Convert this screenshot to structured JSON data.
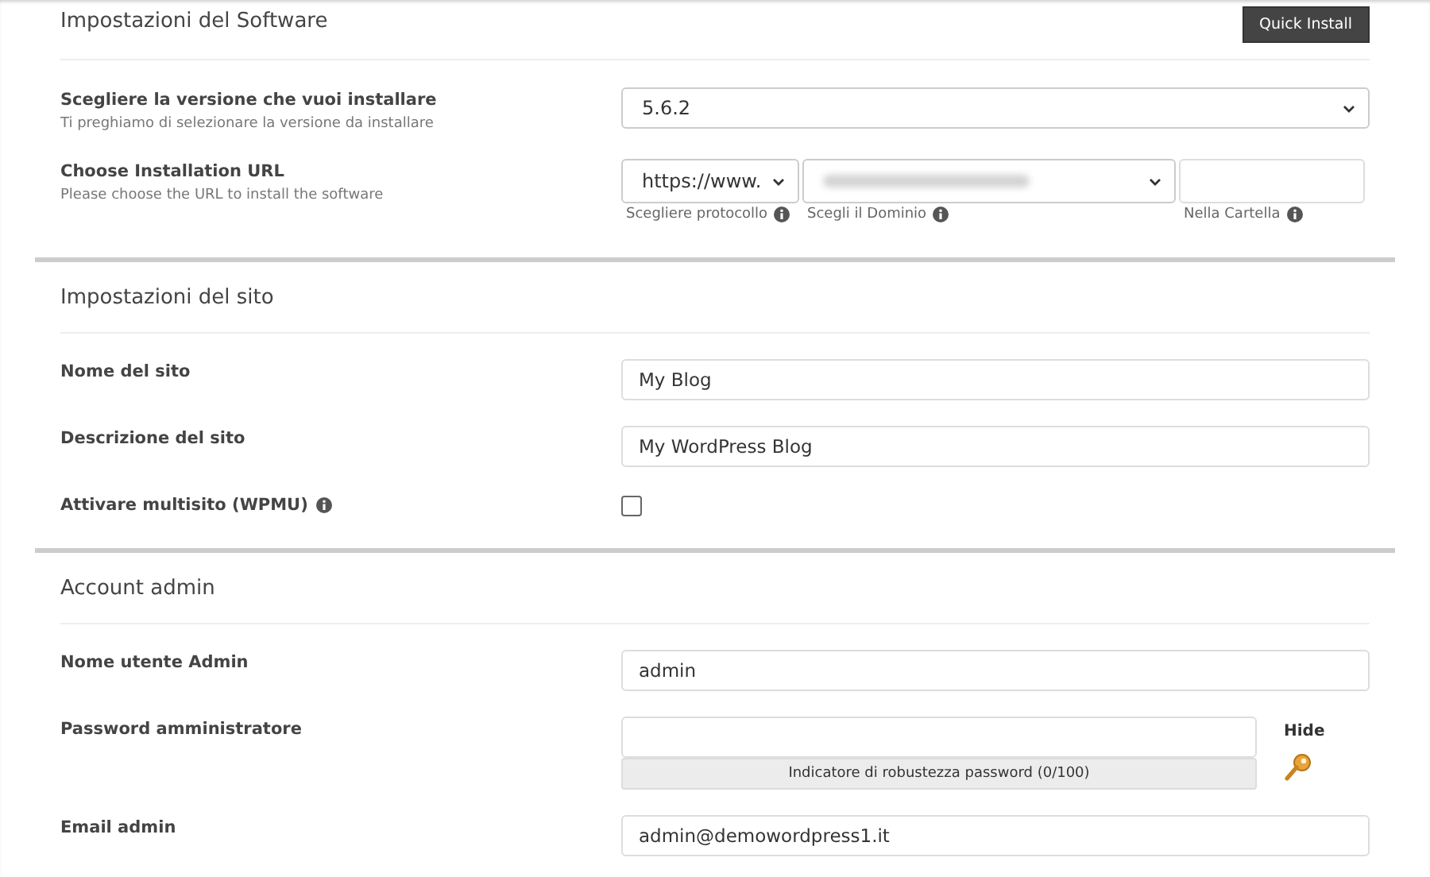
{
  "quick_install": "Quick Install",
  "sections": [
    {
      "title": "Impostazioni del Software",
      "rows": [
        {
          "kind": "select",
          "label": "Scegliere la versione che vuoi installare",
          "hint": "Ti preghiamo di selezionare la versione da installare",
          "value": "5.6.2"
        },
        {
          "kind": "url",
          "label": "Choose Installation URL",
          "hint": "Please choose the URL to install the software",
          "protocol": "https://www.",
          "protocol_caption": "Scegliere protocollo",
          "domain_caption": "Scegli il Dominio",
          "folder_caption": "Nella Cartella"
        }
      ]
    },
    {
      "title": "Impostazioni del sito",
      "rows": [
        {
          "kind": "text",
          "label": "Nome del sito",
          "value": "My Blog"
        },
        {
          "kind": "text",
          "label": "Descrizione del sito",
          "value": "My WordPress Blog"
        },
        {
          "kind": "checkbox",
          "label": "Attivare multisito (WPMU)",
          "checked": false
        }
      ]
    },
    {
      "title": "Account admin",
      "rows": [
        {
          "kind": "text",
          "label": "Nome utente Admin",
          "value": "admin"
        },
        {
          "kind": "password",
          "label": "Password amministratore",
          "toggle": "Hide",
          "meter": "Indicatore di robustezza password (0/100)",
          "level": 0
        },
        {
          "kind": "text",
          "label": "Email admin",
          "value": "admin@demowordpress1.it"
        }
      ]
    }
  ]
}
